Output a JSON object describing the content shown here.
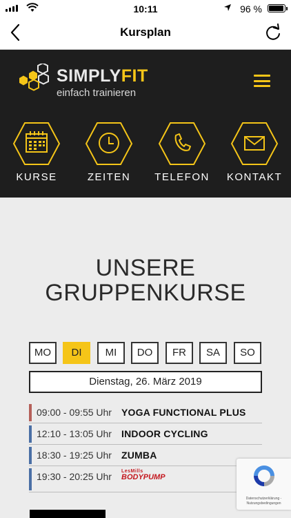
{
  "status_bar": {
    "time": "10:11",
    "battery_text": "96 %",
    "battery_level": 0.96,
    "signal_icon": "cell-signal-icon",
    "wifi_icon": "wifi-icon",
    "location_icon": "location-arrow-icon"
  },
  "nav_bar": {
    "title": "Kursplan",
    "back_icon": "chevron-left-icon",
    "reload_icon": "reload-icon"
  },
  "brand": {
    "name_part1": "SIMPLY",
    "name_part2": "FIT",
    "tagline": "einfach trainieren",
    "accent_color": "#f5c518",
    "header_bg": "#1e1e1e"
  },
  "quick_nav": [
    {
      "label": "KURSE",
      "icon": "calendar-icon"
    },
    {
      "label": "ZEITEN",
      "icon": "clock-icon"
    },
    {
      "label": "TELEFON",
      "icon": "phone-icon"
    },
    {
      "label": "KONTAKT",
      "icon": "mail-icon"
    }
  ],
  "main": {
    "heading_line1": "UNSERE",
    "heading_line2": "GRUPPENKURSE",
    "days": [
      {
        "label": "MO",
        "active": false
      },
      {
        "label": "DI",
        "active": true
      },
      {
        "label": "MI",
        "active": false
      },
      {
        "label": "DO",
        "active": false
      },
      {
        "label": "FR",
        "active": false
      },
      {
        "label": "SA",
        "active": false
      },
      {
        "label": "SO",
        "active": false
      }
    ],
    "selected_date": "Dienstag, 26. März 2019",
    "classes": [
      {
        "time": "09:00 - 09:55 Uhr",
        "name": "YOGA FUNCTIONAL PLUS",
        "color": "#b5605a"
      },
      {
        "time": "12:10 - 13:05 Uhr",
        "name": "INDOOR CYCLING",
        "color": "#4a6fa5"
      },
      {
        "time": "18:30 - 19:25 Uhr",
        "name": "ZUMBA",
        "color": "#4a6fa5"
      },
      {
        "time": "19:30 - 20:25 Uhr",
        "name_logo_top": "LesMills",
        "name_logo_bottom": "BODYPUMP",
        "color": "#4a6fa5"
      }
    ]
  },
  "recaptcha": {
    "text": "Datenschutzerklärung - Nutzungsbedingungen",
    "icon": "recaptcha-icon"
  }
}
